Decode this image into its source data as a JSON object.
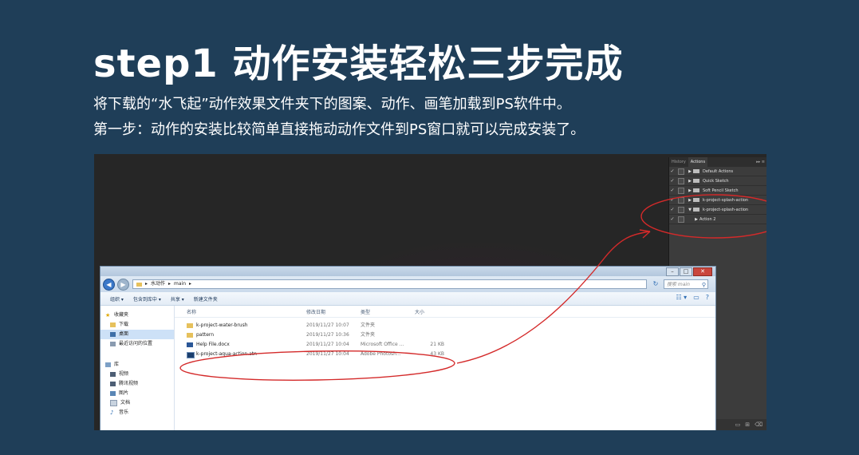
{
  "title": "step1 动作安装轻松三步完成",
  "lines": [
    "将下载的“水飞起”动作效果文件夹下的图案、动作、画笔加载到PS软件中。",
    "第一步：动作的安装比较简单直接拖动动作文件到PS窗口就可以完成安装了。"
  ],
  "ps_panel": {
    "tabs": [
      "History",
      "Actions"
    ],
    "controls": "▸▸ ≡",
    "rows": [
      {
        "label": "Default Actions",
        "expanded": false,
        "folder": true
      },
      {
        "label": "Quick Sketch",
        "expanded": false,
        "folder": true
      },
      {
        "label": "Soft Pencil Sketch",
        "expanded": false,
        "folder": true
      },
      {
        "label": "k-project-splash-action",
        "expanded": false,
        "folder": true
      },
      {
        "label": "k-project-splash-action",
        "expanded": true,
        "folder": true
      },
      {
        "label": "Action 2",
        "expanded": false,
        "folder": false
      }
    ]
  },
  "explorer": {
    "address": [
      "水动作",
      "main"
    ],
    "search_placeholder": "搜索 main",
    "toolbar": [
      "组织 ▾",
      "包含到库中 ▾",
      "共享 ▾",
      "新建文件夹"
    ],
    "nav": [
      {
        "label": "收藏夹",
        "icon": "star-icon"
      },
      {
        "label": "下载",
        "icon": "download-folder-icon"
      },
      {
        "label": "桌面",
        "icon": "desktop-icon",
        "selected": true
      },
      {
        "label": "最近访问的位置",
        "icon": "recent-icon"
      },
      {
        "label": "",
        "icon": ""
      },
      {
        "label": "库",
        "icon": "library-icon"
      },
      {
        "label": "视频",
        "icon": "video-icon"
      },
      {
        "label": "腾讯视频",
        "icon": "video-icon"
      },
      {
        "label": "图片",
        "icon": "picture-icon"
      },
      {
        "label": "文档",
        "icon": "document-icon"
      },
      {
        "label": "音乐",
        "icon": "music-icon"
      }
    ],
    "columns": [
      "名称",
      "修改日期",
      "类型",
      "大小"
    ],
    "files": [
      {
        "name": "k-project-water-brush",
        "date": "2019/11/27 10:07",
        "type": "文件夹",
        "size": "",
        "icon": "folder"
      },
      {
        "name": "pattern",
        "date": "2019/11/27 10:36",
        "type": "文件夹",
        "size": "",
        "icon": "folder"
      },
      {
        "name": "Help File.docx",
        "date": "2019/11/27 10:04",
        "type": "Microsoft Office ...",
        "size": "21 KB",
        "icon": "doc"
      },
      {
        "name": "k-project-aqua-action.atn",
        "date": "2019/11/27 10:04",
        "type": "Adobe Photosh...",
        "size": "43 KB",
        "icon": "atn"
      }
    ]
  },
  "colors": {
    "background": "#1f3e58",
    "annotation": "#d42a2a"
  }
}
